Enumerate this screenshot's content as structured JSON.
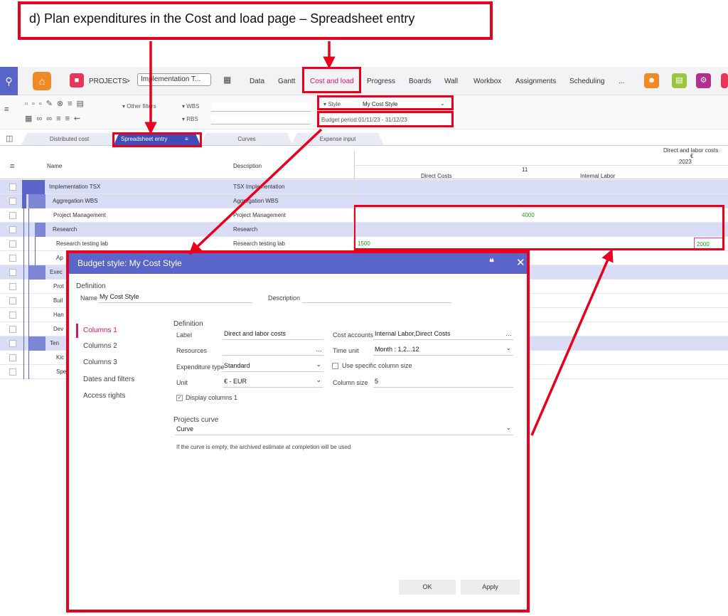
{
  "caption": "d) Plan expenditures in the Cost and load page – Spreadsheet entry",
  "nav": {
    "projects_label": "PROJECTS",
    "breadcrumb_sep": ">",
    "project_select": "Implementation T...",
    "tabs": [
      "Data",
      "Gantt",
      "Cost and load",
      "Progress",
      "Boards",
      "Wall",
      "Workbox",
      "Assignments",
      "Scheduling",
      "..."
    ]
  },
  "toolbar": {
    "other_filters": "Other filters",
    "wbs": "WBS",
    "rbs": "RBS",
    "style_label": "Style",
    "style_value": "My Cost Style",
    "budget_period": "Budget period:01/11/23 - 31/12/23"
  },
  "subtabs": [
    "Distributed cost",
    "Spreadsheet entry",
    "Curves",
    "Expense input"
  ],
  "grid": {
    "col_name": "Name",
    "col_description": "Description",
    "header_group": "Direct and labor costs",
    "currency": "€",
    "year": "2023",
    "month": "11",
    "sub_direct": "Direct Costs",
    "sub_internal": "Internal Labor",
    "rows": [
      {
        "name": "Implementation TSX",
        "desc": "TSX Implementation"
      },
      {
        "name": "Aggregation WBS",
        "desc": "Aggregation WBS"
      },
      {
        "name": "Project Management",
        "desc": "Project Management",
        "v2": "4000"
      },
      {
        "name": "Research",
        "desc": "Research"
      },
      {
        "name": "Research testing lab",
        "desc": "Research testing lab",
        "v1": "1500",
        "v3": "2000"
      },
      {
        "name": "Ap",
        "desc": ""
      },
      {
        "name": "Exec",
        "desc": ""
      },
      {
        "name": "Prot",
        "desc": ""
      },
      {
        "name": "Buil",
        "desc": ""
      },
      {
        "name": "Han",
        "desc": ""
      },
      {
        "name": "Dev",
        "desc": ""
      },
      {
        "name": "Ten",
        "desc": ""
      },
      {
        "name": "Kic",
        "desc": ""
      },
      {
        "name": "Spe",
        "desc": ""
      }
    ]
  },
  "dialog": {
    "title": "Budget style: My Cost Style",
    "definition_header": "Definition",
    "name_label": "Name",
    "name_value": "My Cost Style",
    "description_label": "Description",
    "sidebar": [
      "Columns 1",
      "Columns 2",
      "Columns 3",
      "Dates and filters",
      "Access rights"
    ],
    "section_definition": "Definition",
    "label_label": "Label",
    "label_value": "Direct and labor costs",
    "cost_accounts_label": "Cost accounts",
    "cost_accounts_value": "Internal Labor,Direct Costs",
    "resources_label": "Resources",
    "time_unit_label": "Time unit",
    "time_unit_value": "Month : 1,2...12",
    "expenditure_type_label": "Expenditure type",
    "expenditure_type_value": "Standard",
    "specific_size_label": "Use specific column size",
    "unit_label": "Unit",
    "unit_value": "€ - EUR",
    "column_size_label": "Column size",
    "column_size_value": "5",
    "display_columns_label": "Display columns 1",
    "projects_curve_header": "Projects curve",
    "curve_label": "Curve",
    "curve_note": "If the curve is empty, the archived estimate at completion will be used",
    "ok_label": "OK",
    "apply_label": "Apply"
  },
  "colors": {
    "accent": "#5965c8",
    "highlight": "#e8001c",
    "pink": "#d1156b",
    "value": "#1aa51a"
  }
}
